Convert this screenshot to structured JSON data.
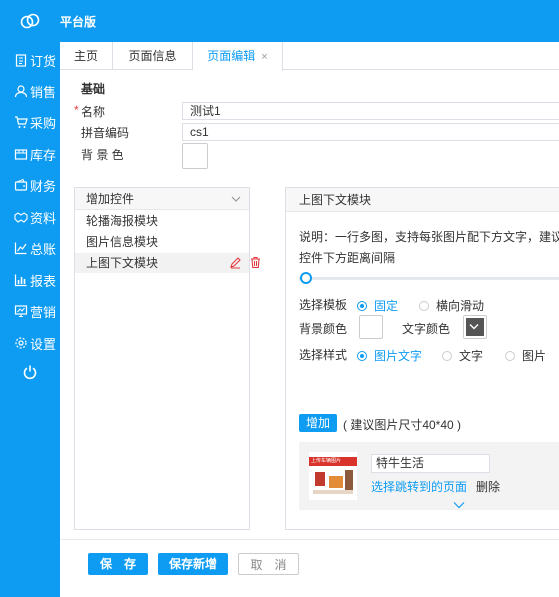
{
  "app": {
    "brand": "平台版",
    "accent_color": "#0e9cf3"
  },
  "sidebar": {
    "items": [
      {
        "label": "订货",
        "icon": "clipboard-icon"
      },
      {
        "label": "销售",
        "icon": "user-icon"
      },
      {
        "label": "采购",
        "icon": "cart-icon"
      },
      {
        "label": "库存",
        "icon": "warehouse-icon"
      },
      {
        "label": "财务",
        "icon": "wallet-icon"
      },
      {
        "label": "资料",
        "icon": "handshake-icon"
      },
      {
        "label": "总账",
        "icon": "line-chart-icon"
      },
      {
        "label": "报表",
        "icon": "bar-chart-icon"
      },
      {
        "label": "营销",
        "icon": "monitor-chart-icon"
      },
      {
        "label": "设置",
        "icon": "gear-icon"
      }
    ],
    "power_icon": "power-icon"
  },
  "tabs": [
    {
      "label": "主页"
    },
    {
      "label": "页面信息"
    },
    {
      "label": "页面编辑",
      "active": true,
      "closable": true,
      "close_glyph": "×"
    }
  ],
  "basic": {
    "section_title": "基础",
    "name_label": "名称",
    "name_value": "测试1",
    "pinyin_label": "拼音编码",
    "pinyin_value": "cs1",
    "bg_color_label": "背 景 色",
    "bg_color": "#ffffff"
  },
  "controls": {
    "header": "增加控件",
    "items": [
      {
        "label": "轮播海报模块",
        "selected": false
      },
      {
        "label": "图片信息模块",
        "selected": false
      },
      {
        "label": "上图下文模块",
        "selected": true
      }
    ]
  },
  "module": {
    "title": "上图下文模块",
    "description": "说明：一行多图，支持每张图片配下方文字，建议",
    "spacing_label": "控件下方距离间隔",
    "spacing_value": 0,
    "template_label": "选择模板",
    "template_options": [
      {
        "label": "固定",
        "selected": true
      },
      {
        "label": "横向滑动",
        "selected": false
      }
    ],
    "bg_color_label": "背景颜色",
    "bg_color": "#ffffff",
    "text_color_label": "文字颜色",
    "text_color": "#555555",
    "style_label": "选择样式",
    "style_options": [
      {
        "label": "图片文字",
        "selected": true
      },
      {
        "label": "文字",
        "selected": false
      },
      {
        "label": "图片",
        "selected": false
      }
    ],
    "add_label": "增加",
    "add_hint": "( 建议图片尺寸40*40 )",
    "card": {
      "thumb_caption": "上传车辆图片",
      "title_value": "特牛生活",
      "link_label": "选择跳转到的页面",
      "delete_label": "删除"
    }
  },
  "footer": {
    "save_label": "保　存",
    "save_new_label": "保存新增",
    "cancel_label": "取　消"
  }
}
